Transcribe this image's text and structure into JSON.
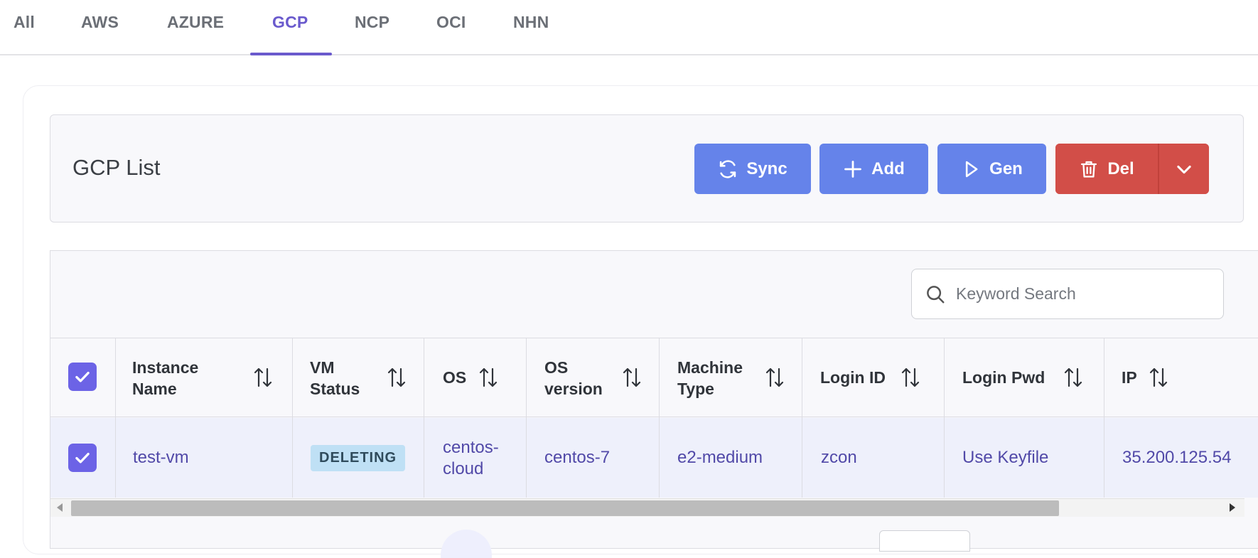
{
  "tabs": [
    {
      "label": "All",
      "active": false
    },
    {
      "label": "AWS",
      "active": false
    },
    {
      "label": "AZURE",
      "active": false
    },
    {
      "label": "GCP",
      "active": true
    },
    {
      "label": "NCP",
      "active": false
    },
    {
      "label": "OCI",
      "active": false
    },
    {
      "label": "NHN",
      "active": false
    }
  ],
  "list": {
    "title": "GCP List",
    "buttons": {
      "sync": "Sync",
      "add": "Add",
      "gen": "Gen",
      "del": "Del"
    }
  },
  "search": {
    "placeholder": "Keyword Search",
    "value": ""
  },
  "table": {
    "select_all_checked": true,
    "columns": [
      {
        "line1": "Instance",
        "line2": "Name"
      },
      {
        "line1": "VM",
        "line2": "Status"
      },
      {
        "line1": "OS",
        "line2": ""
      },
      {
        "line1": "OS",
        "line2": "version"
      },
      {
        "line1": "Machine",
        "line2": "Type"
      },
      {
        "line1": "Login ID",
        "line2": ""
      },
      {
        "line1": "Login Pwd",
        "line2": ""
      },
      {
        "line1": "IP",
        "line2": ""
      }
    ],
    "rows": [
      {
        "checked": true,
        "instance_name": "test-vm",
        "vm_status": "DELETING",
        "os_line1": "centos-",
        "os_line2": "cloud",
        "os_version": "centos-7",
        "machine_type": "e2-medium",
        "login_id": "zcon",
        "login_pwd": "Use Keyfile",
        "ip": "35.200.125.54"
      }
    ]
  },
  "colors": {
    "accent": "#6a5acd",
    "button_blue": "#6583ea",
    "button_red": "#d24e48",
    "checkbox": "#6c63e6",
    "status_badge_bg": "#bfe0f5"
  }
}
